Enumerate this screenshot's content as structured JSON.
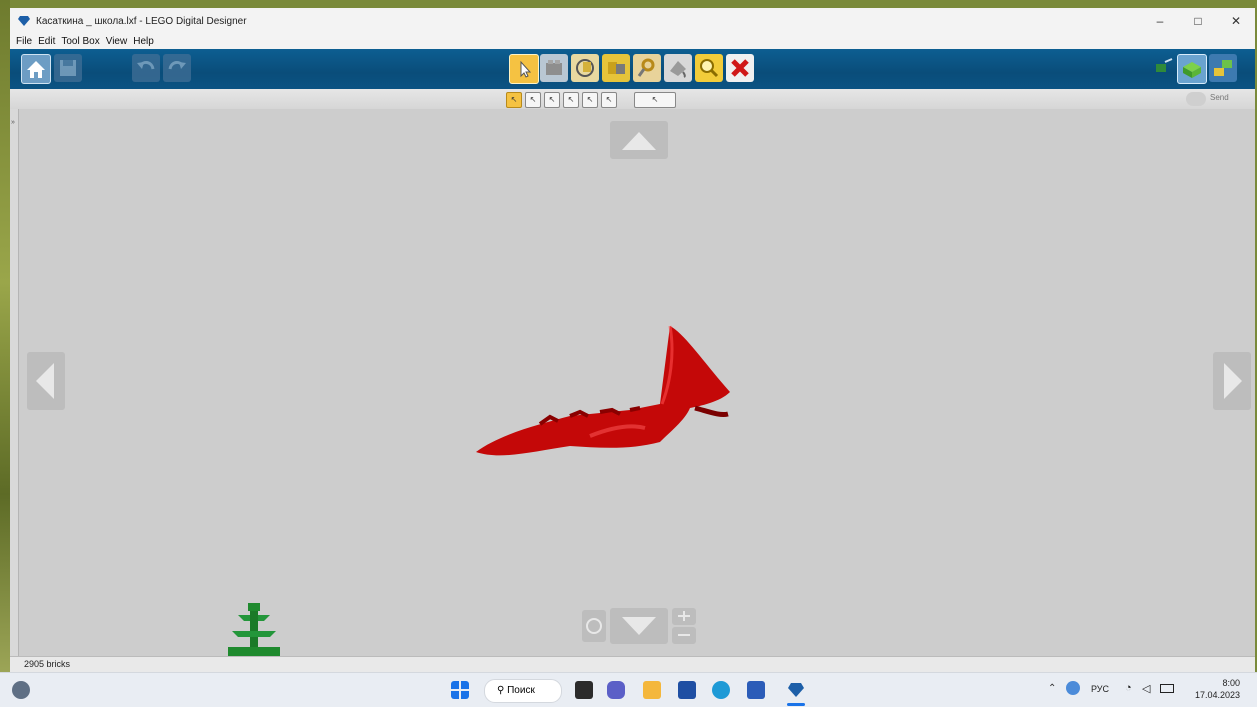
{
  "window": {
    "title": "Касаткина _ школа.lxf - LEGO Digital Designer",
    "controls": {
      "minimize": "–",
      "maximize": "□",
      "close": "✕"
    }
  },
  "menu": [
    "File",
    "Edit",
    "Tool Box",
    "View",
    "Help"
  ],
  "toolbar": {
    "send_label": "Send",
    "tools": [
      "select-tool",
      "clone-tool",
      "hinge-tool",
      "hinge-align-tool",
      "flex-tool",
      "paint-tool",
      "hide-tool",
      "delete-tool"
    ]
  },
  "status": {
    "bricks": "2905 bricks"
  },
  "taskbar": {
    "search_label": "Поиск",
    "language": "РУС",
    "time": "8:00",
    "date": "17.04.2023"
  },
  "colors": {
    "toolbar_blue": "#0b5383",
    "viewport_bg": "#cdcdcd",
    "model_red": "#cc0000",
    "plant_green": "#1f8a2e"
  }
}
